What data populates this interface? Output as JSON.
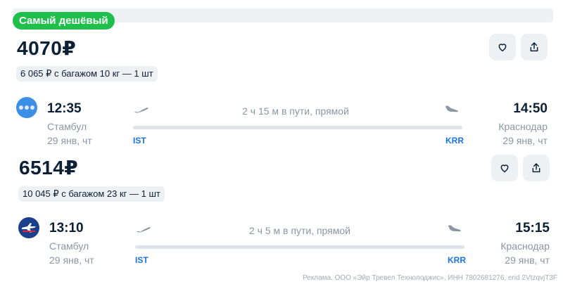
{
  "badge": "Самый дешёвый",
  "ticket1": {
    "price": "4070₽",
    "baggage": "6 065 ₽ с багажом 10 кг — 1 шт",
    "airline_logo": "dots-airline-logo",
    "depart_time": "12:35",
    "depart_city": "Стамбул",
    "depart_date": "29 янв, чт",
    "duration": "2 ч 15 м в пути, прямой",
    "from_code": "IST",
    "to_code": "KRR",
    "arrive_time": "14:50",
    "arrive_city": "Краснодар",
    "arrive_date": "29 янв, чт"
  },
  "ticket2": {
    "price": "6514₽",
    "baggage": "10 045 ₽ с багажом 23 кг — 1 шт",
    "airline_logo": "crane-airline-logo",
    "depart_time": "13:10",
    "depart_city": "Стамбул",
    "depart_date": "29 янв, чт",
    "duration": "2 ч 5 м в пути, прямой",
    "from_code": "IST",
    "to_code": "KRR",
    "arrive_time": "15:15",
    "arrive_city": "Краснодар",
    "arrive_date": "29 янв, чт"
  },
  "icons": {
    "favorite": "heart-icon",
    "share": "share-icon",
    "takeoff": "takeoff-plane-icon",
    "landing": "landing-plane-icon"
  },
  "colors": {
    "badge": "#1fbf4b",
    "airport_code": "#1a73e8",
    "muted_text": "#8a96a3",
    "chip_bg": "#eef1f4"
  },
  "ad_text": "Реклама. ООО «Эйр Тревел Технолоджис», ИНН 7802681276, erid 2VtzqvjT3F"
}
